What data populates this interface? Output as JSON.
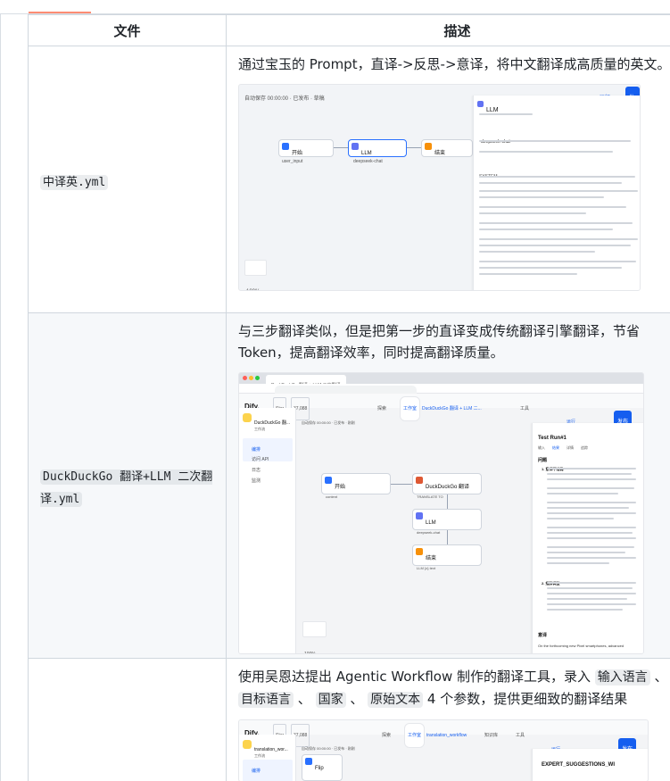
{
  "table": {
    "headers": {
      "file": "文件",
      "desc": "描述"
    },
    "rows": [
      {
        "file": "中译英.yml",
        "desc": "通过宝玉的 Prompt，直译->反思->意译，将中文翻译成高质量的英文。"
      },
      {
        "file": "DuckDuckGo 翻译+LLM 二次翻译.yml",
        "desc": "与三步翻译类似，但是把第一步的直译变成传统翻译引擎翻译，节省 Token，提高翻译效率，同时提高翻译质量。"
      },
      {
        "file": "",
        "desc_before": "使用吴恩达提出 Agentic Workflow 制作的翻译工具，录入 ",
        "tags": [
          "输入语言",
          "目标语言",
          "国家",
          "原始文本"
        ],
        "desc_sep": "、",
        "desc_after": " 4 个参数，提供更细致的翻译结果"
      }
    ]
  },
  "shot1": {
    "header_left": "自动保存 00:00:00 · 已发布 · 草稿",
    "publish_btn": "发布",
    "run_btn": "运行",
    "start_node": "开始",
    "start_var": "user_input",
    "llm_node": "LLM",
    "llm_model": "deepseek-chat",
    "end_node": "结束",
    "panel_title": "LLM",
    "panel_model": "deepseek-chat",
    "panel_system": "SYSTEM",
    "zoom": "100%"
  },
  "shot2": {
    "tab_title": "DuckDuckGo 翻译 + LLM 二次翻译",
    "url": "cloud.dify.ai/app/784a11fe-a030-43b6-8ad6-cb43c1a5d0e0/workflow",
    "brand": "Dify.",
    "star_label": "Star",
    "star_count": "37,088",
    "nav_explore": "探索",
    "nav_studio": "工作室",
    "nav_breadcrumb": "DuckDuckGo 翻译 + LLM 二...",
    "nav_tools": "工具",
    "app_name": "DuckDuckGo 翻...",
    "app_type": "工作流",
    "side_items": [
      "编排",
      "访问 API",
      "日志",
      "监测"
    ],
    "canvas_info": "自动保存 00:00:00 · 已发布 · 刚刚",
    "run_btn": "运行",
    "publish_btn": "发布",
    "nodes": {
      "start": "开始",
      "start_var": "content",
      "ddg": "DuckDuckGo 翻译",
      "ddg_sub": "TRANSLATE TO",
      "llm": "LLM",
      "llm_model": "deepseek-chat",
      "end": "结束",
      "end_var": "LLM {x} text"
    },
    "result_panel": {
      "title": "Test Run#1",
      "tabs": [
        "输入",
        "结果",
        "详情",
        "追踪"
      ],
      "section": "问题",
      "item1": "1. 意译不准确",
      "item2": "2. 措辞调整",
      "footer": "意译",
      "last_line": "On the forthcoming new Pixel smartphones, advanced"
    },
    "zoom": "100%"
  },
  "shot3": {
    "brand": "Dify.",
    "star_label": "Star",
    "star_count": "37,088",
    "nav_explore": "探索",
    "nav_studio": "工作室",
    "nav_app": "translation_workflow",
    "nav_kb": "知识库",
    "nav_tools": "工具",
    "app_name": "translation_wor...",
    "app_type": "工作流",
    "side_first": "编排",
    "canvas_info": "自动保存 00:00:00 · 已发布 · 刚刚",
    "node_title": "Flip",
    "panel_title": "EXPERT_SUGGESTIONS_WI",
    "run_btn": "运行",
    "publish_btn": "发布"
  }
}
